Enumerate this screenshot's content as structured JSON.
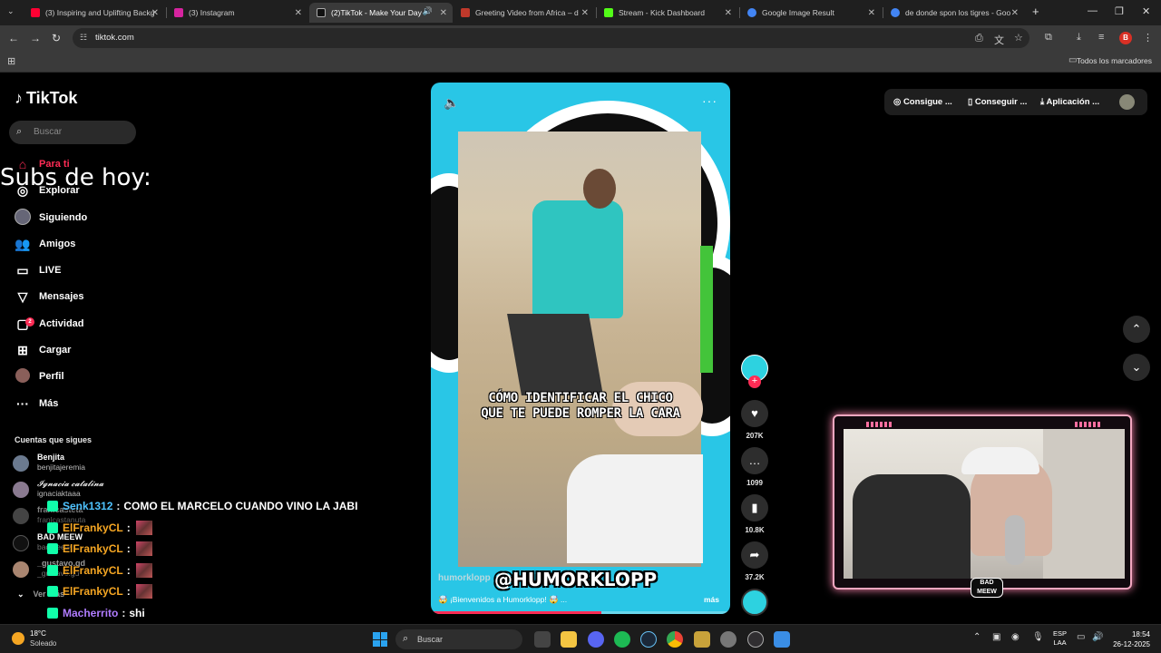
{
  "browser": {
    "tabs": [
      {
        "title": "(3) Inspiring and Uplifting Backg",
        "fav_color": "#ff0033"
      },
      {
        "title": "(3) Instagram",
        "fav_color": "#d6249f"
      },
      {
        "title": "(2)TikTok - Make Your Day",
        "fav_color": "#111111"
      },
      {
        "title": "Greeting Video from Africa – d",
        "fav_color": "#c0392b"
      },
      {
        "title": "Stream - Kick Dashboard",
        "fav_color": "#53fc18"
      },
      {
        "title": "Google Image Result",
        "fav_color": "#4285f4"
      },
      {
        "title": "de donde spon los tigres - Goo",
        "fav_color": "#4285f4"
      }
    ],
    "url": "tiktok.com",
    "bookmarks_label": "Todos los marcadores",
    "profile_initial": "B"
  },
  "tiktok": {
    "logo": "TikTok",
    "search_placeholder": "Buscar",
    "nav": [
      {
        "label": "Para ti",
        "icon": "home-icon",
        "active": true
      },
      {
        "label": "Explorar",
        "icon": "compass-icon"
      },
      {
        "label": "Siguiendo",
        "icon": "following-avatar-icon"
      },
      {
        "label": "Amigos",
        "icon": "friends-icon"
      },
      {
        "label": "LIVE",
        "icon": "live-icon"
      },
      {
        "label": "Mensajes",
        "icon": "messages-icon"
      },
      {
        "label": "Actividad",
        "icon": "activity-icon",
        "badge": "2"
      },
      {
        "label": "Cargar",
        "icon": "upload-icon"
      },
      {
        "label": "Perfil",
        "icon": "profile-icon"
      },
      {
        "label": "Más",
        "icon": "more-icon"
      }
    ],
    "following_title": "Cuentas que sigues",
    "following": [
      {
        "name": "Benjita",
        "handle": "benjitajeremia"
      },
      {
        "name": "𝓘𝓰𝓷𝓪𝓬𝓲𝓪 𝓬𝓪𝓽𝓪𝓵𝓲𝓷𝓪",
        "handle": "ignaciaktaaa"
      },
      {
        "name": "franlcasteta",
        "handle": "franlcastanuta"
      },
      {
        "name": "BAD MEEW",
        "handle": "badmeew"
      },
      {
        "name": "_gustavo.gd",
        "handle": "_gustavo.gd"
      }
    ],
    "see_more": "Ver más",
    "top_right": {
      "item1": "Consigue ...",
      "item2": "Conseguir ...",
      "item3": "Aplicación ..."
    },
    "video": {
      "caption_line1": "CÓMO IDENTIFICAR EL CHICO",
      "caption_line2": "QUE TE PUEDE ROMPER LA CARA",
      "watermark": "@HUMORKLOPP",
      "author": "humorklopp",
      "description": "🤯 ¡Bienvenidos a Humorklopp! 🤯 ...",
      "more": "más",
      "progress": 0.57
    },
    "actions": {
      "likes": "207K",
      "comments": "1099",
      "saves": "10.8K",
      "shares": "37.2K"
    }
  },
  "overlay": {
    "subs_title": "Subs de hoy:",
    "chat": [
      {
        "user": "Senk1312",
        "user_color": "#4ec3ff",
        "message": "COMO EL MARCELO CUANDO VINO LA JABI",
        "emote": false
      },
      {
        "user": "ElFrankyCL",
        "user_color": "#f5a623",
        "message": "",
        "emote": true
      },
      {
        "user": "ElFrankyCL",
        "user_color": "#f5a623",
        "message": "",
        "emote": true
      },
      {
        "user": "ElFrankyCL",
        "user_color": "#f5a623",
        "message": "",
        "emote": true
      },
      {
        "user": "ElFrankyCL",
        "user_color": "#f5a623",
        "message": "",
        "emote": true
      },
      {
        "user": "Macherrito",
        "user_color": "#b07cff",
        "message": "shi",
        "emote": false
      }
    ],
    "cam_logo": "BAD MEEW"
  },
  "taskbar": {
    "temperature": "18°C",
    "weather": "Soleado",
    "search_placeholder": "Buscar",
    "lang_line1": "ESP",
    "lang_line2": "LAA",
    "time": "18:54",
    "date": "26-12-2025"
  }
}
